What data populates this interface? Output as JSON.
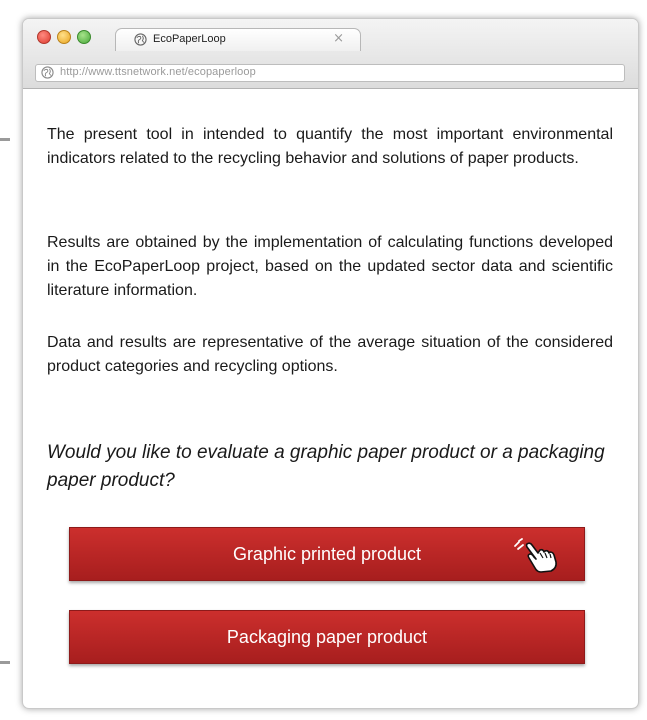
{
  "browser": {
    "tab_title": "EcoPaperLoop",
    "tab_close": "×",
    "url": "http://www.ttsnetwork.net/ecopaperloop"
  },
  "intro": {
    "paragraph1": "The present tool in intended to quantify the most important environmental indicators related to the recycling behavior and solutions of paper products.",
    "paragraph2": "Results are obtained by the implementation of calculating functions developed in the EcoPaperLoop project, based on the updated sector data and scientific literature information.",
    "paragraph3": "Data and results are representative of the average situation of the considered product categories and recycling options."
  },
  "question": "Would you like to evaluate a graphic paper product or  a packaging paper product?",
  "buttons": {
    "graphic": "Graphic printed product",
    "packaging": "Packaging paper product"
  },
  "colors": {
    "button_red": "#b82525",
    "text": "#1a1a1a",
    "url_gray": "#9a9a9a"
  },
  "icons": {
    "tab": "globe-icon",
    "address": "globe-icon",
    "cursor": "pointing-hand-cursor-icon"
  }
}
